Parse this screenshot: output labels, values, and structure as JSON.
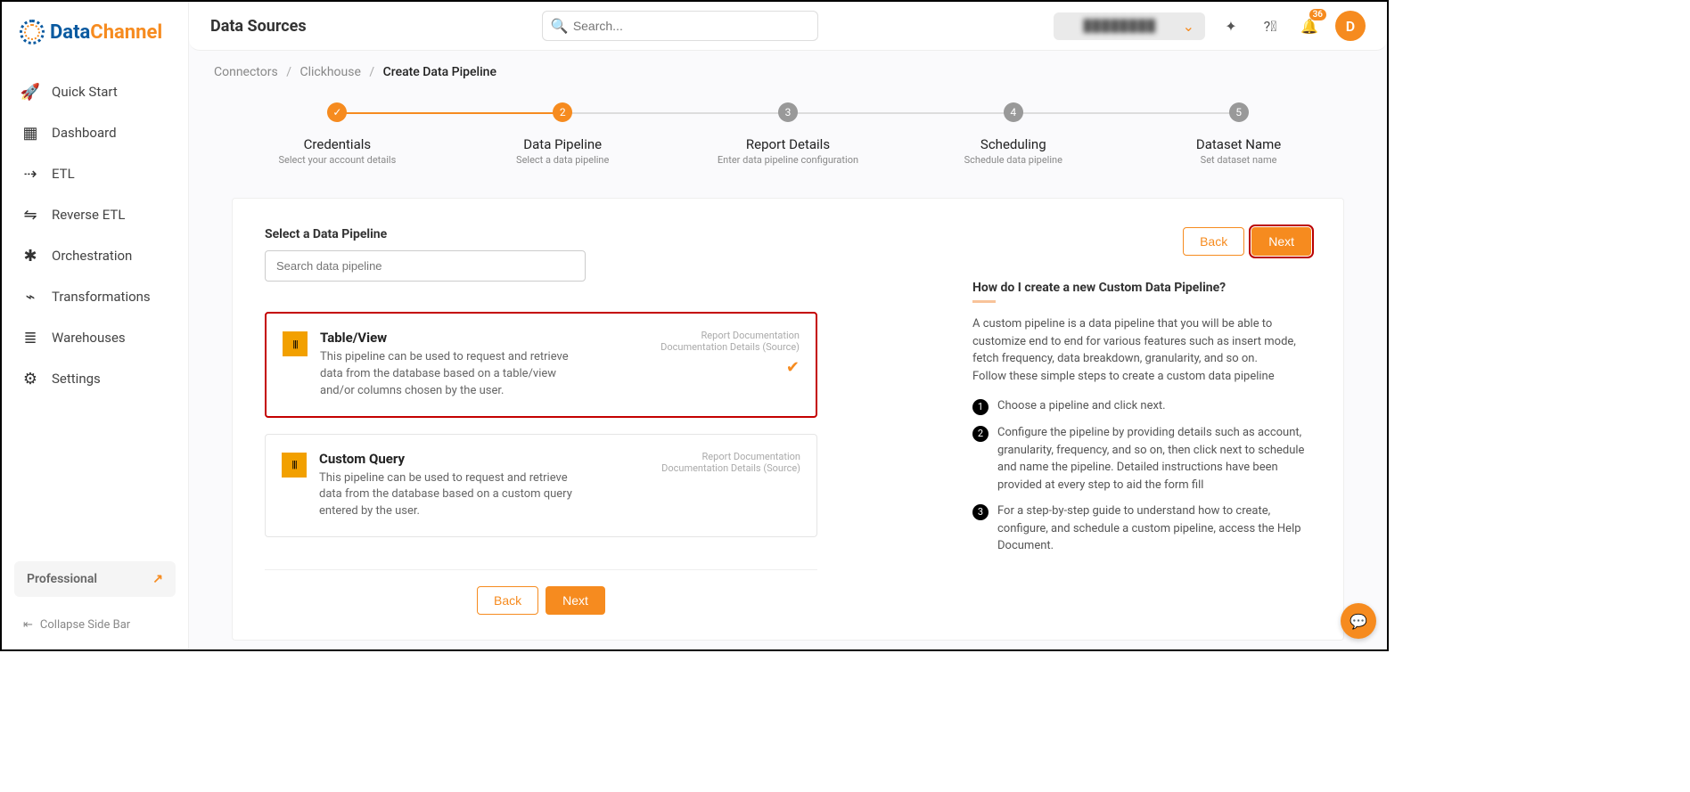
{
  "brand": {
    "blue": "Data",
    "orange": "Channel"
  },
  "sidebar": {
    "items": [
      {
        "label": "Quick Start"
      },
      {
        "label": "Dashboard"
      },
      {
        "label": "ETL"
      },
      {
        "label": "Reverse ETL"
      },
      {
        "label": "Orchestration"
      },
      {
        "label": "Transformations"
      },
      {
        "label": "Warehouses"
      },
      {
        "label": "Settings"
      }
    ],
    "plan": "Professional",
    "collapse": "Collapse Side Bar"
  },
  "header": {
    "title": "Data Sources",
    "search_placeholder": "Search...",
    "notification_count": "36",
    "avatar_initial": "D"
  },
  "breadcrumb": {
    "a": "Connectors",
    "b": "Clickhouse",
    "c": "Create Data Pipeline"
  },
  "steps": [
    {
      "num": "✓",
      "title": "Credentials",
      "sub": "Select your account details"
    },
    {
      "num": "2",
      "title": "Data Pipeline",
      "sub": "Select a data pipeline"
    },
    {
      "num": "3",
      "title": "Report Details",
      "sub": "Enter data pipeline configuration"
    },
    {
      "num": "4",
      "title": "Scheduling",
      "sub": "Schedule data pipeline"
    },
    {
      "num": "5",
      "title": "Dataset Name",
      "sub": "Set dataset name"
    }
  ],
  "card": {
    "section_title": "Select a Data Pipeline",
    "search_placeholder": "Search data pipeline",
    "back": "Back",
    "next": "Next",
    "pipelines": [
      {
        "title": "Table/View",
        "desc": "This pipeline can be used to request and retrieve data from the database based on a table/view and/or columns chosen by the user.",
        "meta1": "Report Documentation",
        "meta2": "Documentation Details (Source)"
      },
      {
        "title": "Custom Query",
        "desc": "This pipeline can be used to request and retrieve data from the database based on a custom query entered by the user.",
        "meta1": "Report Documentation",
        "meta2": "Documentation Details (Source)"
      }
    ],
    "help": {
      "title": "How do I create a new Custom Data Pipeline?",
      "para1": "A custom pipeline is a data pipeline that you will be able to customize end to end for various features such as insert mode, fetch frequency, data breakdown, granularity, and so on.",
      "para2": "Follow these simple steps to create a custom data pipeline",
      "items": [
        "Choose a pipeline and click next.",
        "Configure the pipeline by providing details such as account, granularity, frequency, and so on, then click next to schedule and name the pipeline. Detailed instructions have been provided at every step to aid the form fill",
        "For a step-by-step guide to understand how to create, configure, and schedule a custom pipeline, access the Help Document."
      ]
    }
  }
}
